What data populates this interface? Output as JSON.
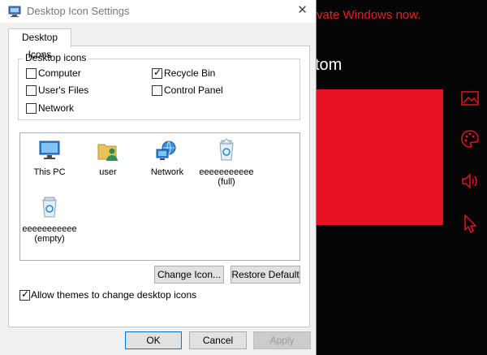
{
  "window": {
    "title": "Desktop Icon Settings"
  },
  "tabs": [
    {
      "label": "Desktop Icons"
    }
  ],
  "desktop_icons_group": {
    "legend": "Desktop icons",
    "checkboxes": [
      {
        "label": "Computer",
        "checked": false
      },
      {
        "label": "Recycle Bin",
        "checked": true
      },
      {
        "label": "User's Files",
        "checked": false
      },
      {
        "label": "Control Panel",
        "checked": false
      },
      {
        "label": "Network",
        "checked": false
      }
    ]
  },
  "icon_list": [
    {
      "label": "This PC",
      "icon": "computer-icon"
    },
    {
      "label": "user",
      "icon": "user-folder-icon"
    },
    {
      "label": "Network",
      "icon": "network-icon"
    },
    {
      "label": "eeeeeeeeeee\n(full)",
      "icon": "recycle-bin-full-icon"
    },
    {
      "label": "eeeeeeeeeee\n(empty)",
      "icon": "recycle-bin-empty-icon"
    }
  ],
  "buttons": {
    "change_icon": "Change Icon...",
    "restore_default": "Restore Default",
    "ok": "OK",
    "cancel": "Cancel",
    "apply": "Apply"
  },
  "allow_themes": {
    "label": "Allow themes to change desktop icons",
    "checked": true
  },
  "background": {
    "activate_text": "vate Windows now.",
    "heading_fragment": "tom",
    "accent_color": "#e81123",
    "side_icons": [
      "picture-icon",
      "palette-icon",
      "sound-icon",
      "cursor-icon"
    ]
  }
}
